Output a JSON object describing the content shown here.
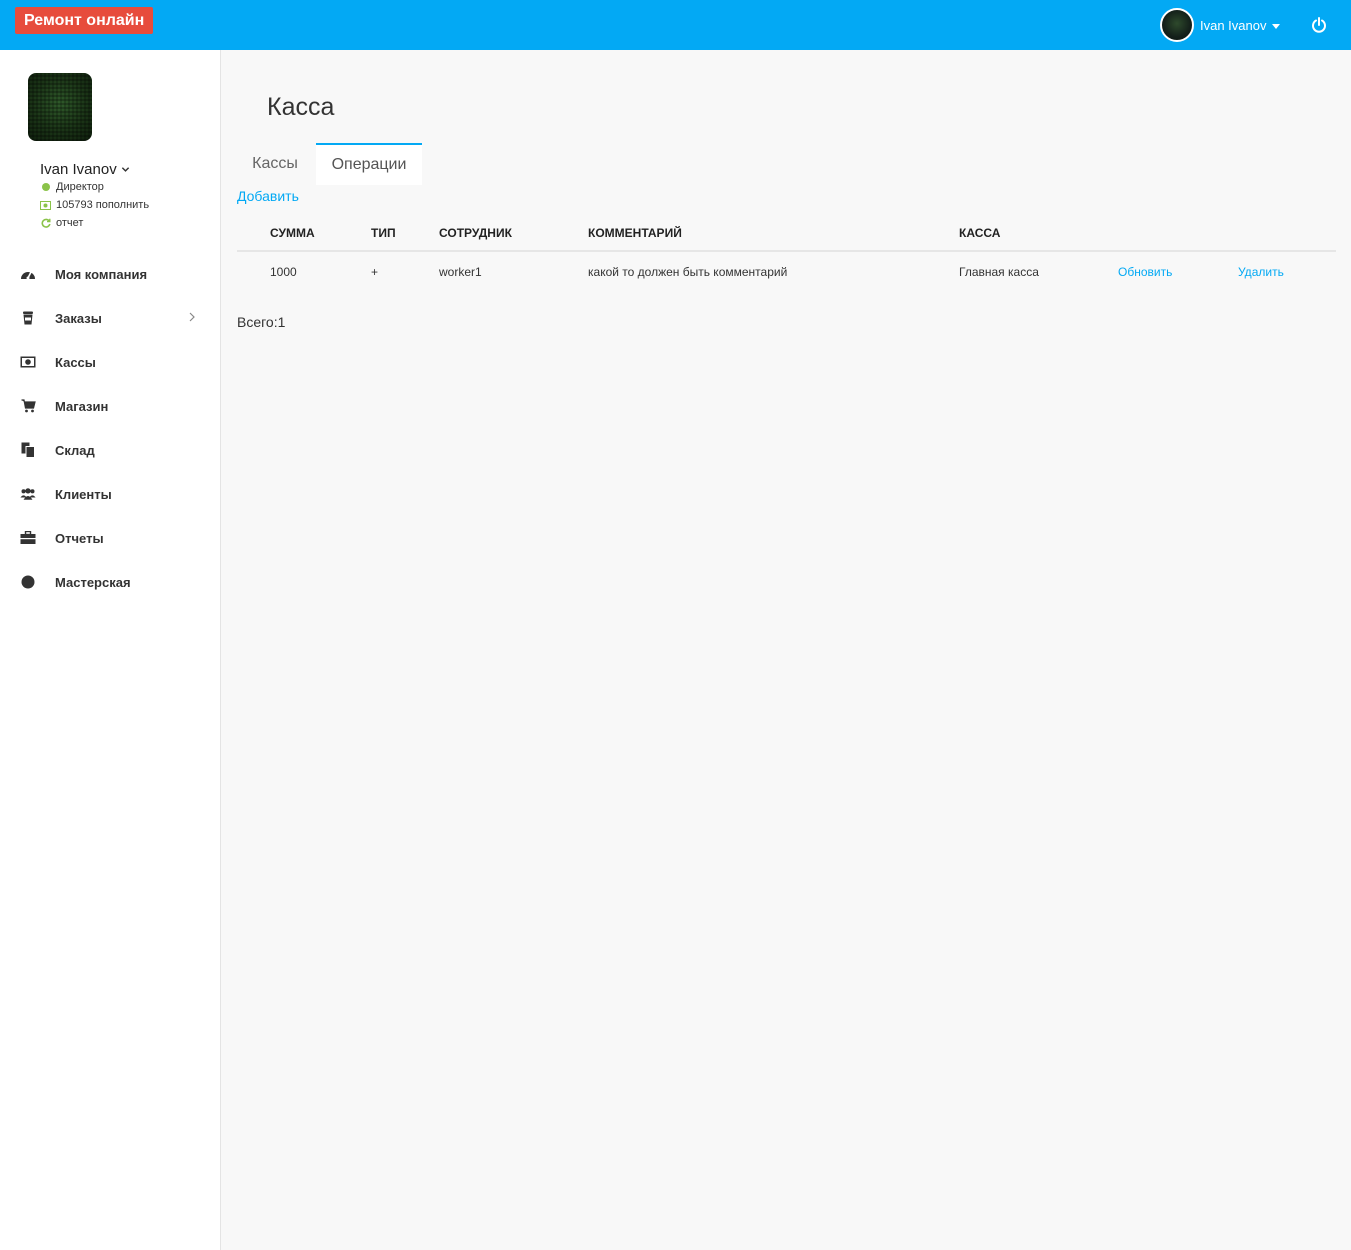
{
  "header": {
    "brand": "Ремонт онлайн",
    "user_name": "Ivan Ivanov"
  },
  "sidebar": {
    "profile": {
      "name": "Ivan Ivanov",
      "role": "Директор",
      "balance": "105793 пополнить",
      "report": "отчет"
    },
    "items": [
      {
        "label": "Моя компания",
        "icon": "dashboard-icon"
      },
      {
        "label": "Заказы",
        "icon": "cup-icon"
      },
      {
        "label": "Кассы",
        "icon": "money-icon"
      },
      {
        "label": "Магазин",
        "icon": "cart-icon"
      },
      {
        "label": "Склад",
        "icon": "copy-icon"
      },
      {
        "label": "Клиенты",
        "icon": "users-icon"
      },
      {
        "label": "Отчеты",
        "icon": "briefcase-icon"
      },
      {
        "label": "Мастерская",
        "icon": "circle-icon"
      }
    ]
  },
  "main": {
    "title": "Касса",
    "tabs": [
      "Кассы",
      "Операции"
    ],
    "add_label": "Добавить",
    "table": {
      "headers": [
        "СУММА",
        "ТИП",
        "СОТРУДНИК",
        "КОММЕНТАРИЙ",
        "КАССА"
      ],
      "rows": [
        {
          "sum": "1000",
          "type": "+",
          "employee": "worker1",
          "comment": "какой то должен быть комментарий",
          "kassa": "Главная касса",
          "update": "Обновить",
          "delete": "Удалить"
        }
      ]
    },
    "total": "Всего:1"
  },
  "colors": {
    "topbar": "#03a9f4",
    "brand_badge": "#e74c3c",
    "link": "#03a9f4",
    "status_online": "#8bc34a"
  }
}
